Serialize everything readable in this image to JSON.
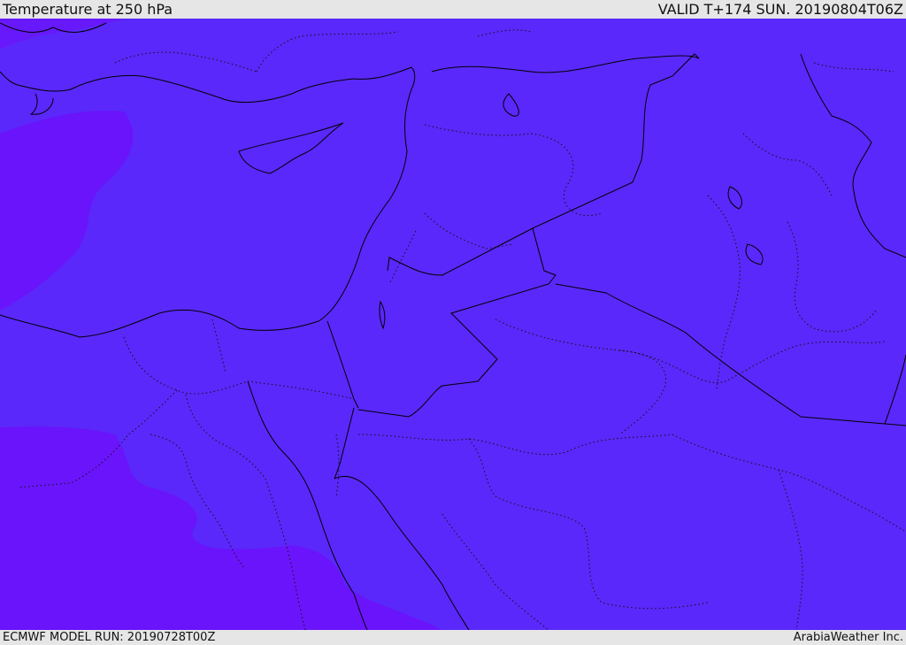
{
  "header": {
    "title": "Temperature at 250 hPa",
    "valid": "VALID T+174 SUN. 20190804T06Z"
  },
  "footer": {
    "model_run": "ECMWF MODEL RUN: 20190728T00Z",
    "credit": "ArabiaWeather Inc."
  },
  "colors": {
    "field_main": "#5a28fa",
    "field_cold": "#6c12fb",
    "border": "#000000",
    "background": "#e6e6e6"
  }
}
